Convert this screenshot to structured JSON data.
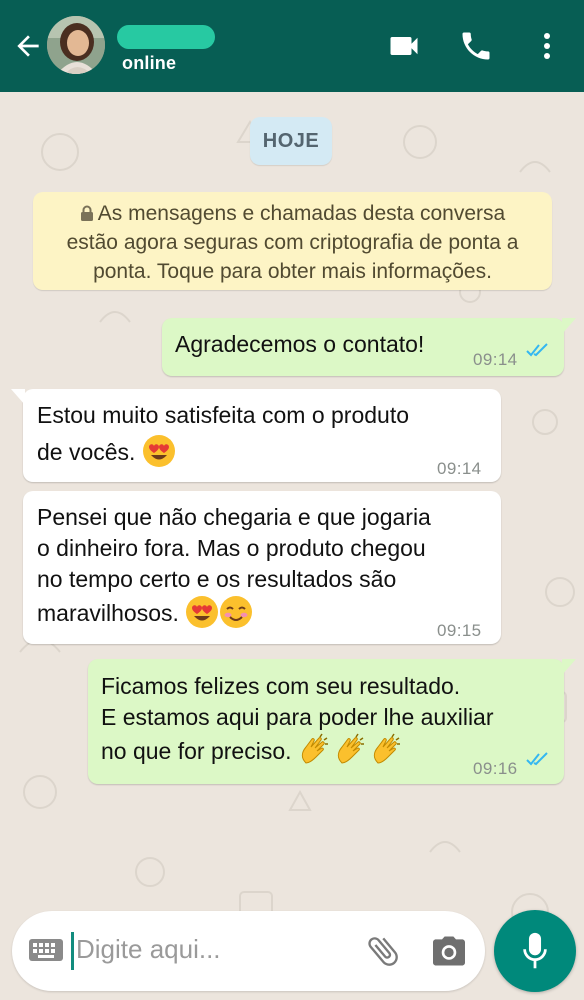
{
  "header": {
    "status": "online",
    "icons": [
      "back-arrow-icon",
      "avatar",
      "video-call-icon",
      "phone-icon",
      "more-vert-icon"
    ]
  },
  "chat": {
    "date_chip": "HOJE",
    "encryption_notice": {
      "line1": "As mensagens e chamadas desta conversa",
      "line2": "estão agora seguras com criptografia de ponta a",
      "line3": "ponta. Toque para obter mais informações."
    },
    "messages": [
      {
        "direction": "out",
        "lines": [
          "Agradecemos o contato!"
        ],
        "time": "09:14",
        "read": true
      },
      {
        "direction": "in",
        "lines": [
          "Estou muito satisfeita com o produto",
          "de vocês."
        ],
        "emojis": [
          "heart-eyes"
        ],
        "time": "09:14"
      },
      {
        "direction": "in",
        "lines": [
          "Pensei que não chegaria e que jogaria",
          "o dinheiro fora. Mas o produto chegou",
          "no tempo certo e os resultados são",
          "maravilhosos."
        ],
        "emojis": [
          "heart-eyes",
          "smiling-blush"
        ],
        "time": "09:15"
      },
      {
        "direction": "out",
        "lines": [
          "Ficamos felizes com seu resultado.",
          "E estamos aqui para poder lhe auxiliar",
          "no que for preciso."
        ],
        "emojis": [
          "clapping-hands",
          "clapping-hands",
          "clapping-hands"
        ],
        "time": "09:16",
        "read": true
      }
    ]
  },
  "composer": {
    "placeholder": "Digite aqui..."
  },
  "colors": {
    "header": "#075e54",
    "outgoing_bubble": "#dcf8c6",
    "incoming_bubble": "#ffffff",
    "read_ticks": "#34b7f1",
    "mic_button": "#00897b",
    "notice": "#fdf4c5"
  }
}
